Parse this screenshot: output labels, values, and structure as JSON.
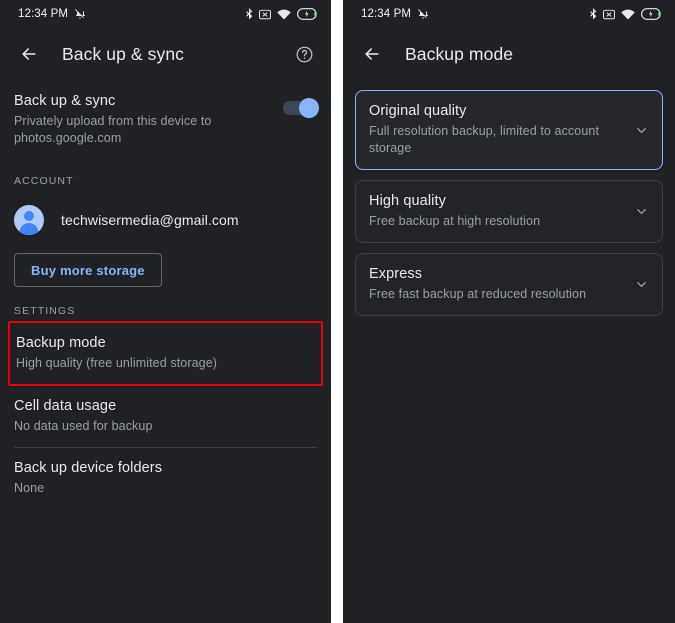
{
  "statusbar": {
    "time": "12:34 PM",
    "dnd_icon": "notifications-off-icon",
    "icons": [
      "bluetooth-icon",
      "vibrate-off-icon",
      "wifi-icon",
      "battery-charging-icon"
    ]
  },
  "colors": {
    "background": "#202124",
    "card": "#232427",
    "accent_blue": "#8ab4f8",
    "avatar_blue": "#aecbfa",
    "highlight_red": "#e8000a",
    "text_primary": "#e8eaed",
    "text_secondary": "#9aa0a6",
    "divider": "#3c4043",
    "gutter": "#ffffff"
  },
  "left_panel": {
    "appbar": {
      "back_icon": "arrow-left-icon",
      "title": "Back up & sync",
      "help_icon": "help-circle-icon"
    },
    "master_toggle": {
      "title": "Back up & sync",
      "subtitle": "Privately upload from this device to photos.google.com",
      "state": "on"
    },
    "account_section": {
      "label": "ACCOUNT",
      "email": "techwisermedia@gmail.com",
      "avatar_icon": "person-avatar-icon",
      "buy_storage_label": "Buy more storage"
    },
    "settings_section": {
      "label": "SETTINGS",
      "items": [
        {
          "title": "Backup mode",
          "subtitle": "High quality (free unlimited storage)",
          "highlighted": true
        },
        {
          "title": "Cell data usage",
          "subtitle": "No data used for backup",
          "highlighted": false
        },
        {
          "title": "Back up device folders",
          "subtitle": "None",
          "highlighted": false
        }
      ]
    }
  },
  "right_panel": {
    "appbar": {
      "back_icon": "arrow-left-icon",
      "title": "Backup mode"
    },
    "options": [
      {
        "title": "Original quality",
        "subtitle": "Full resolution backup, limited to account storage",
        "selected": true,
        "chevron_icon": "chevron-down-icon"
      },
      {
        "title": "High quality",
        "subtitle": "Free backup at high resolution",
        "selected": false,
        "chevron_icon": "chevron-down-icon"
      },
      {
        "title": "Express",
        "subtitle": "Free fast backup at reduced resolution",
        "selected": false,
        "chevron_icon": "chevron-down-icon"
      }
    ]
  }
}
